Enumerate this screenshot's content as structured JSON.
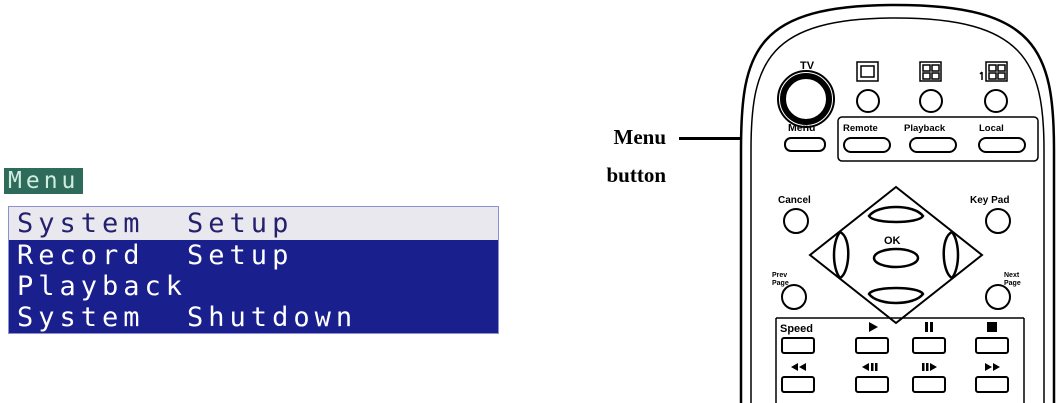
{
  "osd_menu": {
    "title": "Menu",
    "items": [
      {
        "label": "System  Setup",
        "selected": true
      },
      {
        "label": "Record  Setup",
        "selected": false
      },
      {
        "label": "Playback",
        "selected": false
      },
      {
        "label": "System  Shutdown",
        "selected": false
      }
    ],
    "colors": {
      "title_bg": "#2f6b5b",
      "list_bg": "#1a1f8e",
      "selected_bg": "#e8e8ee"
    }
  },
  "callout": {
    "line1": "Menu",
    "line2": "button"
  },
  "remote": {
    "tv_label": "TV",
    "menu_label": "Menu",
    "source_labels": [
      "Remote",
      "Playback",
      "Local"
    ],
    "cancel_label": "Cancel",
    "keypad_label": "Key Pad",
    "ok_label": "OK",
    "prev_label_1": "Prev",
    "prev_label_2": "Page",
    "next_label_1": "Next",
    "next_label_2": "Page",
    "speed_label": "Speed",
    "layout_icons": [
      "single-view-icon",
      "quad-view-icon",
      "multi-view-icon"
    ],
    "transport_icons": [
      "play-icon",
      "pause-icon",
      "stop-icon",
      "rewind-icon",
      "step-back-icon",
      "step-forward-icon",
      "fast-forward-icon"
    ]
  }
}
